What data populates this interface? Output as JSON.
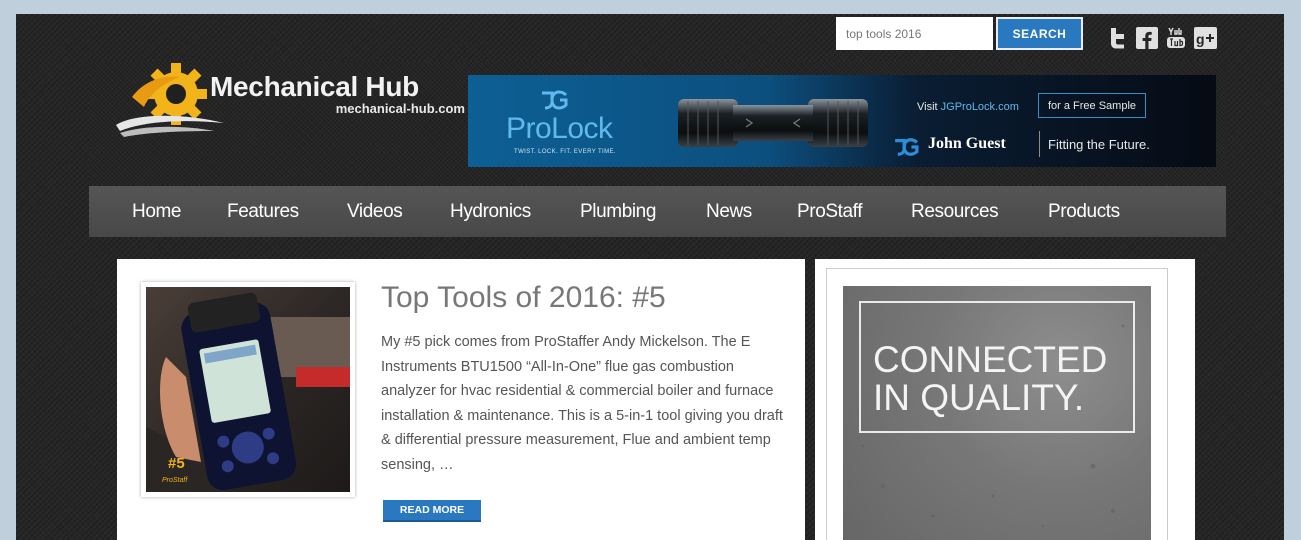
{
  "search": {
    "value": "top tools 2016",
    "button_label": "SEARCH"
  },
  "social": [
    "twitter-icon",
    "facebook-icon",
    "youtube-icon",
    "google-plus-icon"
  ],
  "logo": {
    "title": "Mechanical Hub",
    "subtitle": "mechanical-hub.com"
  },
  "banner": {
    "brand_mark": "JG",
    "product": "ProLock",
    "tagline": "TWIST. LOCK. FIT. EVERY TIME.",
    "visit_prefix": "Visit ",
    "visit_link": "JGProLock.com",
    "sample_label": "for a Free Sample",
    "company": "John Guest",
    "slogan": "Fitting the Future."
  },
  "nav": [
    "Home",
    "Features",
    "Videos",
    "Hydronics",
    "Plumbing",
    "News",
    "ProStaff",
    "Resources",
    "Products"
  ],
  "article": {
    "title": "Top Tools of 2016: #5",
    "excerpt": "My #5 pick comes from ProStaffer Andy Mickelson. The E Instruments BTU1500 “All-In-One” flue gas combustion analyzer for hvac residential & commercial boiler and furnace installation & maintenance. This is a 5-in-1 tool giving you draft & differential pressure measurement, Flue and ambient temp sensing, …",
    "read_more": "READ MORE",
    "thumb_badge": "#5",
    "thumb_brand": "ProStaff"
  },
  "sidebar_ad": {
    "text": "CONNECTED\nIN QUALITY."
  },
  "colors": {
    "accent": "#2a78c0",
    "nav": "#4d4d4d",
    "banner_blue": "#5fb9ec"
  }
}
